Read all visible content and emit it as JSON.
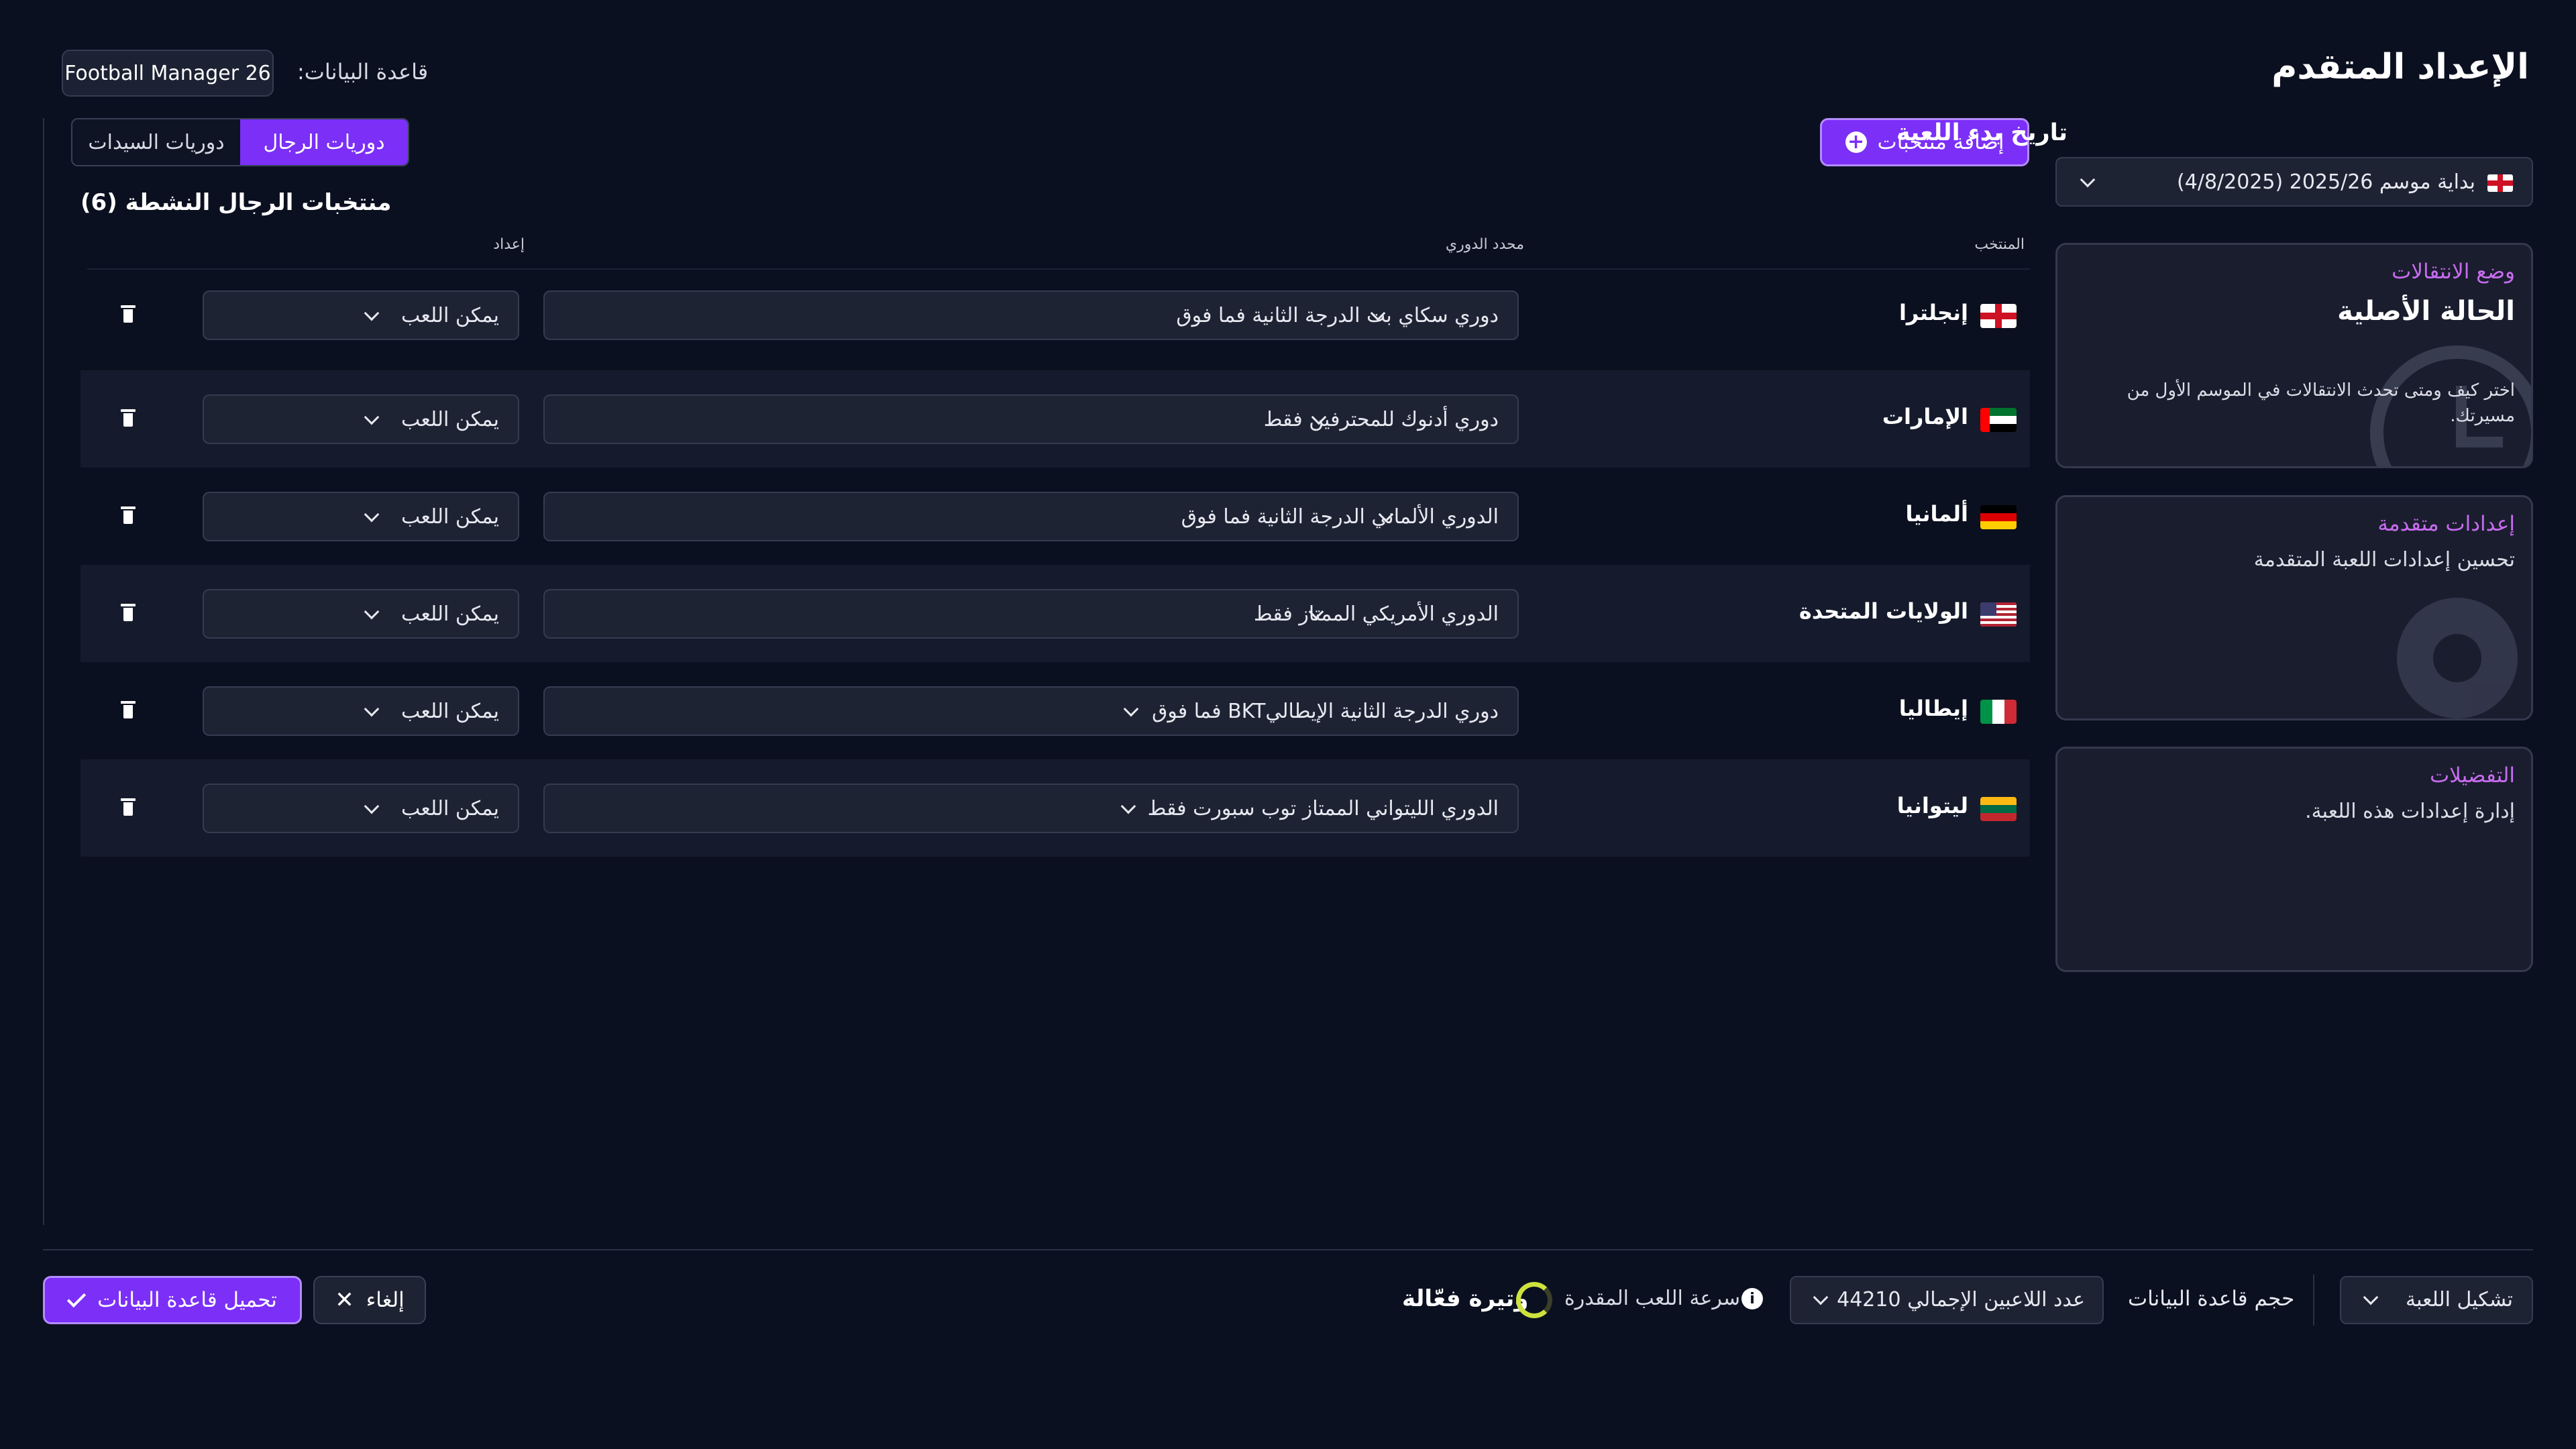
{
  "header": {
    "title": "الإعداد المتقدم",
    "database_label": "قاعدة البيانات:",
    "database_value": "Football Manager 26"
  },
  "tabs": {
    "men": "دوريات الرجال",
    "women": "دوريات السيدات",
    "active": "men"
  },
  "add_nations_button": "إضافة منتخبات",
  "section_title": "منتخبات الرجال النشطة (6)",
  "columns": {
    "nation": "المنتخب",
    "league": "محدد الدوري",
    "setup": "إعداد"
  },
  "rows": [
    {
      "nation": "إنجلترا",
      "league": "دوري سكاي بت الدرجة الثانية فما فوق",
      "setup": "يمكن اللعب",
      "flag": "england"
    },
    {
      "nation": "الإمارات",
      "league": "دوري أدنوك للمحترفين فقط",
      "setup": "يمكن اللعب",
      "flag": "uae"
    },
    {
      "nation": "ألمانيا",
      "league": "الدوري الألماني الدرجة الثانية فما فوق",
      "setup": "يمكن اللعب",
      "flag": "germany"
    },
    {
      "nation": "الولايات المتحدة",
      "league": "الدوري الأمريكي الممتاز فقط",
      "setup": "يمكن اللعب",
      "flag": "usa"
    },
    {
      "nation": "إيطاليا",
      "league": "دوري الدرجة الثانية الإيطاليBKT فما فوق",
      "setup": "يمكن اللعب",
      "flag": "italy"
    },
    {
      "nation": "ليتوانيا",
      "league": "الدوري الليتواني الممتاز توب سبورت فقط",
      "setup": "يمكن اللعب",
      "flag": "lithuania"
    }
  ],
  "sidebar": {
    "start_date_label": "تاريخ بدء اللعبة",
    "start_date_value": "بداية موسم 2025/26 (4/8/2025)",
    "transfer_card": {
      "kicker": "وضع الانتقالات",
      "title": "الحالة الأصلية",
      "description": "اختر كيف ومتى تحدث الانتقالات في الموسم الأول من مسيرتك."
    },
    "advanced_card": {
      "kicker": "إعدادات متقدمة",
      "description": "تحسين إعدادات اللعبة المتقدمة"
    },
    "preferences_card": {
      "kicker": "التفضيلات",
      "description": "إدارة إعدادات هذه اللعبة."
    }
  },
  "footer": {
    "load_button": "تحميل قاعدة البيانات",
    "cancel_button": "إلغاء",
    "pace_label": "وتيرة فعّالة",
    "speed_label": "سرعة اللعب المقدرة",
    "players_value": "عدد اللاعبين الإجمالي 44210",
    "db_size_label": "حجم قاعدة البيانات",
    "formation_value": "تشكيل اللعبة"
  },
  "colors": {
    "accent": "#7b2ff7",
    "kicker": "#c86cf0",
    "pace_ring": "#cde23d"
  }
}
